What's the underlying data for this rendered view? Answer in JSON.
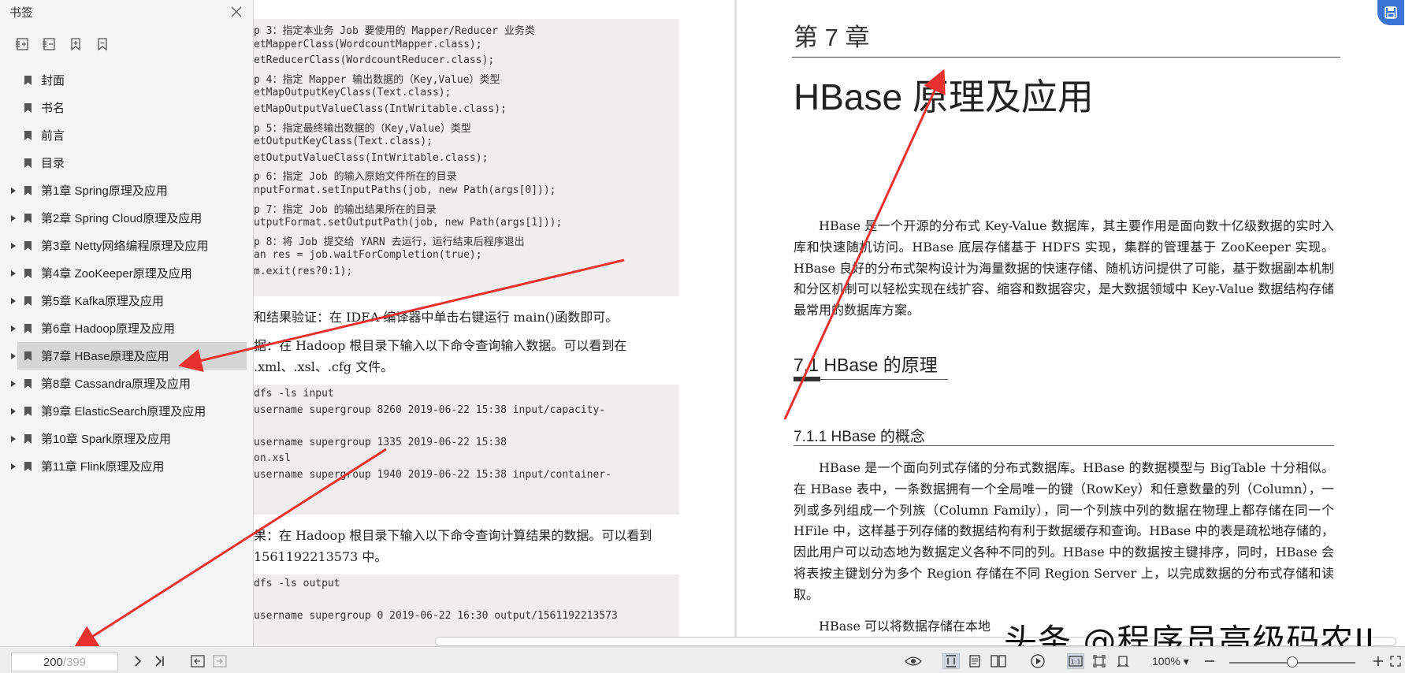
{
  "sidebar": {
    "title": "书签",
    "tools": [
      "expand-all-icon",
      "collapse-all-icon",
      "add-bookmark-icon",
      "bookmark-icon"
    ],
    "items": [
      {
        "label": "封面",
        "expandable": false,
        "selected": false
      },
      {
        "label": "书名",
        "expandable": false,
        "selected": false
      },
      {
        "label": "前言",
        "expandable": false,
        "selected": false
      },
      {
        "label": "目录",
        "expandable": false,
        "selected": false
      },
      {
        "label": "第1章 Spring原理及应用",
        "expandable": true,
        "selected": false
      },
      {
        "label": "第2章 Spring Cloud原理及应用",
        "expandable": true,
        "selected": false
      },
      {
        "label": "第3章 Netty网络编程原理及应用",
        "expandable": true,
        "selected": false
      },
      {
        "label": "第4章 ZooKeeper原理及应用",
        "expandable": true,
        "selected": false
      },
      {
        "label": "第5章 Kafka原理及应用",
        "expandable": true,
        "selected": false
      },
      {
        "label": "第6章 Hadoop原理及应用",
        "expandable": true,
        "selected": false
      },
      {
        "label": "第7章 HBase原理及应用",
        "expandable": true,
        "selected": true
      },
      {
        "label": "第8章 Cassandra原理及应用",
        "expandable": true,
        "selected": false
      },
      {
        "label": "第9章 ElasticSearch原理及应用",
        "expandable": true,
        "selected": false
      },
      {
        "label": "第10章 Spark原理及应用",
        "expandable": true,
        "selected": false
      },
      {
        "label": "第11章 Flink原理及应用",
        "expandable": true,
        "selected": false
      }
    ]
  },
  "left_page": {
    "code1": [
      "p 3：指定本业务 Job 要使用的 Mapper/Reducer 业务类",
      "etMapperClass(WordcountMapper.class);",
      "etReducerClass(WordcountReducer.class);",
      "p 4：指定 Mapper 输出数据的（Key,Value）类型",
      "etMapOutputKeyClass(Text.class);",
      "etMapOutputValueClass(IntWritable.class);",
      "p 5：指定最终输出数据的（Key,Value）类型",
      "etOutputKeyClass(Text.class);",
      "etOutputValueClass(IntWritable.class);",
      "p 6：指定 Job 的输入原始文件所在的目录",
      "nputFormat.setInputPaths(job, new Path(args[0]));",
      "p 7：指定 Job 的输出结果所在的目录",
      "utputFormat.setOutputPath(job, new Path(args[1]));",
      "p 8：将 Job 提交给 YARN 去运行，运行结束后程序退出",
      "an res = job.waitForCompletion(true);",
      "m.exit(res?0:1);"
    ],
    "para1": "和结果验证：在 IDEA 编译器中单击右键运行 main()函数即可。",
    "para2": [
      "据：在  Hadoop  根目录下输入以下命令查询输入数据。可以看到在",
      ".xml、.xsl、.cfg 文件。"
    ],
    "code2": [
      " dfs -ls input",
      " username supergroup 8260 2019-06-22 15:38 input/capacity-",
      "",
      " username supergroup 1335 2019-06-22 15:38",
      "on.xsl",
      " username supergroup 1940 2019-06-22 15:38 input/container-"
    ],
    "para3": [
      "果：在 Hadoop 根目录下输入以下命令查询计算结果的数据。可以看到",
      "1561192213573 中。"
    ],
    "code3": [
      "dfs -ls output",
      "",
      " username supergroup 0 2019-06-22 16:30 output/1561192213573"
    ]
  },
  "right_page": {
    "chapter_no": "第 7 章",
    "chapter_title": "HBase 原理及应用",
    "intro": "HBase 是一个开源的分布式 Key-Value 数据库，其主要作用是面向数十亿级数据的实时入库和快速随机访问。HBase 底层存储基于 HDFS 实现，集群的管理基于 ZooKeeper 实现。HBase 良好的分布式架构设计为海量数据的快速存储、随机访问提供了可能，基于数据副本机制和分区机制可以轻松实现在线扩容、缩容和数据容灾，是大数据领域中 Key-Value 数据结构存储最常用的数据库方案。",
    "section1": "7.1    HBase 的原理",
    "section2": "7.1.1    HBase 的概念",
    "para_concept": "HBase 是一个面向列式存储的分布式数据库。HBase 的数据模型与 BigTable 十分相似。在 HBase 表中，一条数据拥有一个全局唯一的键（RowKey）和任意数量的列（Column），一列或多列组成一个列族（Column Family），同一个列族中列的数据在物理上都存储在同一个 HFile 中，这样基于列存储的数据结构有利于数据缓存和查询。HBase 中的表是疏松地存储的，因此用户可以动态地为数据定义各种不同的列。HBase 中的数据按主键排序，同时，HBase 会将表按主键划分为多个 Region 存储在不同 Region Server 上，以完成数据的分布式存储和读取。",
    "para_last": "HBase 可以将数据存储在本地"
  },
  "bottombar": {
    "current_page": "200",
    "total_pages": "/399",
    "zoom": "100%",
    "zoom_level": 0.5
  },
  "watermark": "头条 @程序员高级码农II",
  "colors": {
    "accent": "#3b74d6",
    "annotation_arrow": "#e8312f"
  }
}
